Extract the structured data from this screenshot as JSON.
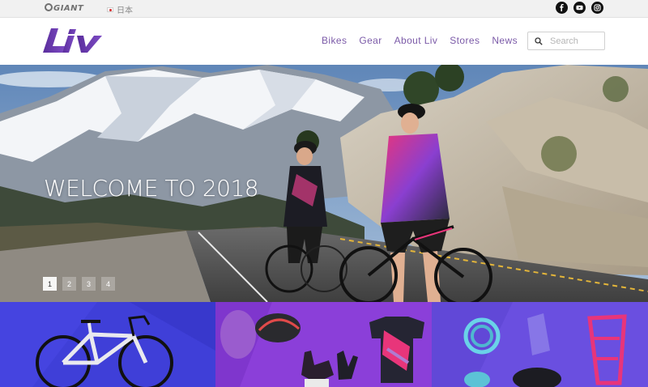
{
  "topbar": {
    "brand": "GIANT",
    "region_label": "日本",
    "social": [
      {
        "icon": "facebook-icon"
      },
      {
        "icon": "youtube-icon"
      },
      {
        "icon": "instagram-icon"
      }
    ]
  },
  "header": {
    "logo_text": "Liv",
    "nav": [
      {
        "label": "Bikes"
      },
      {
        "label": "Gear"
      },
      {
        "label": "About Liv"
      },
      {
        "label": "Stores"
      },
      {
        "label": "News"
      }
    ],
    "search": {
      "placeholder": "Search",
      "value": ""
    }
  },
  "hero": {
    "title": "WELCOME TO 2018",
    "slides": [
      "1",
      "2",
      "3",
      "4"
    ],
    "active_slide": "1"
  },
  "tiles": [
    {
      "category": "bikes",
      "background": "#3f3fd8"
    },
    {
      "category": "apparel",
      "background": "#8b3fd9"
    },
    {
      "category": "accessories",
      "background": "#6a4fe0"
    }
  ],
  "colors": {
    "brand_purple": "#6c3fb0",
    "nav_text": "#7b5aa8"
  }
}
